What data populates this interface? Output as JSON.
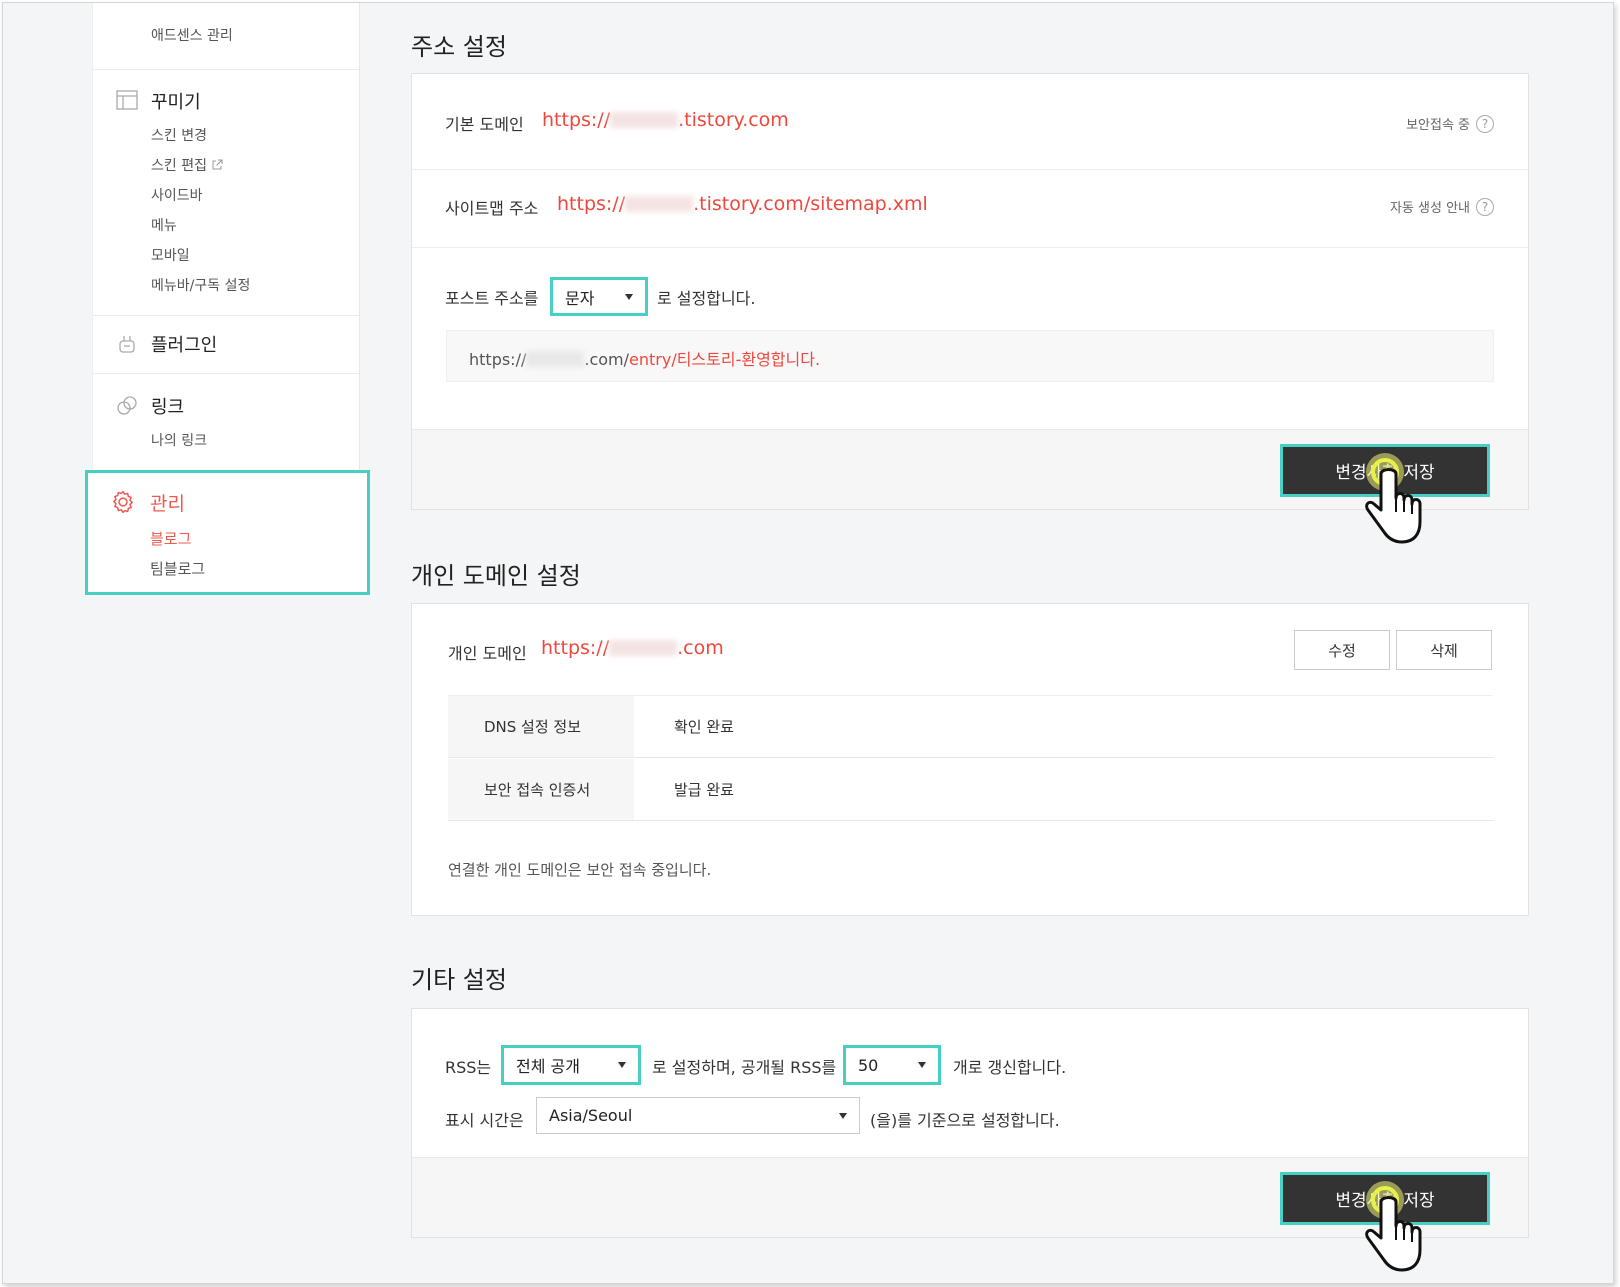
{
  "sidebar": {
    "adsense": "애드센스 관리",
    "decorate": {
      "title": "꾸미기",
      "items": [
        "스킨 변경",
        "스킨 편집",
        "사이드바",
        "메뉴",
        "모바일",
        "메뉴바/구독 설정"
      ]
    },
    "plugin": {
      "title": "플러그인"
    },
    "link": {
      "title": "링크",
      "items": [
        "나의 링크"
      ]
    },
    "manage": {
      "title": "관리",
      "items": [
        "블로그",
        "팀블로그"
      ]
    }
  },
  "address": {
    "title": "주소 설정",
    "default_domain_label": "기본 도메인",
    "default_domain_prefix": "https://",
    "default_domain_suffix": ".tistory.com",
    "secure_note": "보안접속 중",
    "sitemap_label": "사이트맵 주소",
    "sitemap_prefix": "https://",
    "sitemap_suffix": ".tistory.com/sitemap.xml",
    "sitemap_note": "자동 생성 안내",
    "post_addr_prefix": "포스트 주소를",
    "post_addr_select": "문자",
    "post_addr_suffix": "로 설정합니다.",
    "preview_prefix": "https://",
    "preview_mid": ".com/",
    "preview_path": "entry/티스토리-환영합니다.",
    "save_label": "변경사항 저장",
    "question_mark": "?"
  },
  "personal_domain": {
    "title": "개인 도메인 설정",
    "label": "개인 도메인",
    "url_prefix": "https://",
    "url_suffix": ".com",
    "edit_label": "수정",
    "delete_label": "삭제",
    "rows": [
      {
        "key": "DNS 설정 정보",
        "value": "확인 완료"
      },
      {
        "key": "보안 접속 인증서",
        "value": "발급 완료"
      }
    ],
    "note": "연결한 개인 도메인은 보안 접속 중입니다."
  },
  "other": {
    "title": "기타 설정",
    "rss_prefix": "RSS는",
    "rss_select": "전체 공개",
    "rss_mid": "로 설정하며, 공개될 RSS를",
    "rss_count_select": "50",
    "rss_suffix": "개로 갱신합니다.",
    "tz_prefix": "표시 시간은",
    "tz_select": "Asia/Seoul",
    "tz_suffix": "(을)를 기준으로 설정합니다.",
    "save_label": "변경사항 저장"
  },
  "colors": {
    "accent_red": "#f0473d",
    "highlight_teal": "#45d0c3",
    "button_dark": "#333333"
  }
}
